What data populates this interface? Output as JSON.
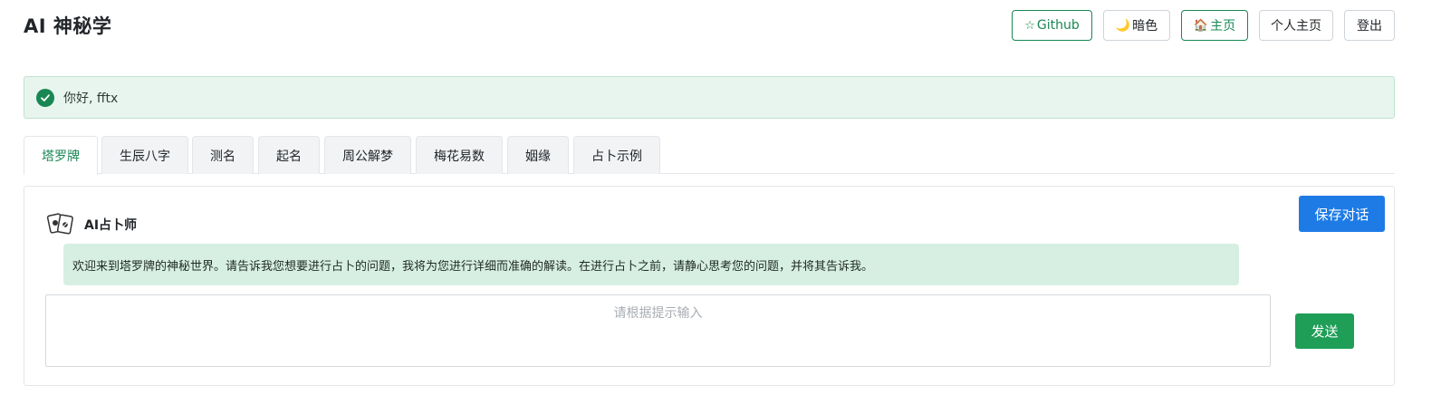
{
  "header": {
    "title": "AI 神秘学",
    "buttons": {
      "github": {
        "icon": "star-icon",
        "glyph": "☆",
        "label": "Github"
      },
      "theme": {
        "icon": "moon-icon",
        "glyph": "🌙",
        "label": "暗色"
      },
      "home": {
        "icon": "house-icon",
        "glyph": "🏠",
        "label": "主页"
      },
      "profile": {
        "label": "个人主页"
      },
      "logout": {
        "label": "登出"
      }
    }
  },
  "alert": {
    "icon": "check-circle-icon",
    "text": "你好, fftx"
  },
  "tabs": [
    {
      "label": "塔罗牌",
      "active": true
    },
    {
      "label": "生辰八字",
      "active": false
    },
    {
      "label": "测名",
      "active": false
    },
    {
      "label": "起名",
      "active": false
    },
    {
      "label": "周公解梦",
      "active": false
    },
    {
      "label": "梅花易数",
      "active": false
    },
    {
      "label": "姻缘",
      "active": false
    },
    {
      "label": "占卜示例",
      "active": false
    }
  ],
  "chat": {
    "save_label": "保存对话",
    "bot": {
      "avatar_icon": "tarot-cards-icon",
      "name": "AI占卜师"
    },
    "message": "欢迎来到塔罗牌的神秘世界。请告诉我您想要进行占卜的问题，我将为您进行详细而准确的解读。在进行占卜之前，请静心思考您的问题，并将其告诉我。",
    "input": {
      "value": "",
      "placeholder": "请根据提示输入"
    },
    "send_label": "发送"
  },
  "colors": {
    "accent_green": "#198754",
    "alert_bg": "#e8f5ee",
    "bubble_bg": "#d7efe2",
    "save_blue": "#1e7be6",
    "send_green": "#1e9e57"
  }
}
